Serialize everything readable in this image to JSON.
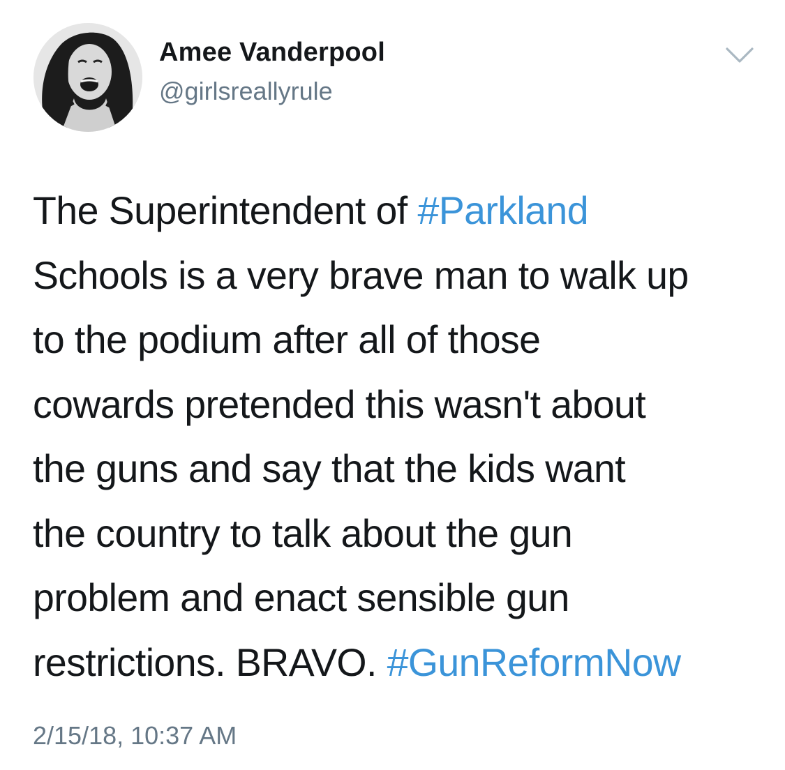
{
  "tweet": {
    "author": {
      "display_name": "Amee Vanderpool",
      "handle": "@girlsreallyrule",
      "avatar_icon": "profile-photo"
    },
    "menu_icon": "chevron-down-icon",
    "body": {
      "lines": [
        [
          "The Superintendent of ",
          "#Parkland"
        ],
        [
          "Schools is a very brave man to walk up"
        ],
        [
          "to the podium after all of those"
        ],
        [
          "cowards pretended this wasn't about"
        ],
        [
          "the guns and say that the kids want"
        ],
        [
          "the country to talk about the gun"
        ],
        [
          "problem and enact sensible gun"
        ],
        [
          "restrictions. BRAVO. ",
          "#GunReformNow"
        ]
      ]
    },
    "timestamp": "2/15/18, 10:37 AM",
    "colors": {
      "text": "#14171a",
      "secondary": "#657786",
      "hashtag": "#3b94d9"
    }
  }
}
